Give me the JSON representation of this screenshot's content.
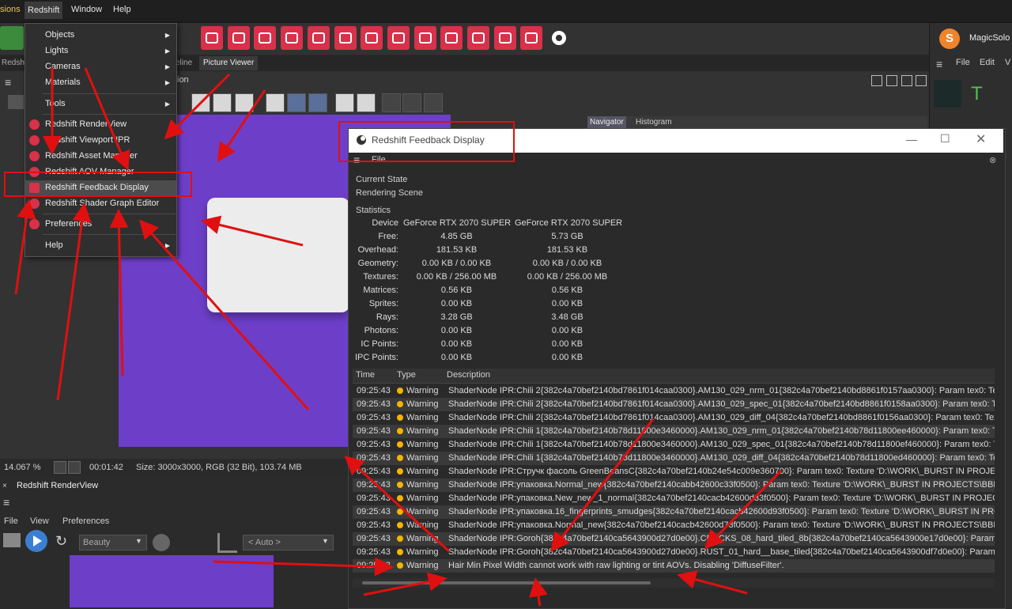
{
  "menubar": {
    "extensions": "sions",
    "redshift": "Redshift",
    "window": "Window",
    "help": "Help"
  },
  "menu": {
    "objects": "Objects",
    "lights": "Lights",
    "cameras": "Cameras",
    "materials": "Materials",
    "tools": "Tools",
    "renderview": "Redshift RenderView",
    "viewport_ipr": "Redshift Viewport IPR",
    "asset_manager": "Redshift Asset Manager",
    "aov_manager": "Redshift AOV Manager",
    "feedback_display": "Redshift Feedback Display",
    "shader_graph": "Redshift Shader Graph Editor",
    "preferences": "Preferences",
    "help": "Help"
  },
  "tabs": {
    "left": "Redsh",
    "timeline": "eline",
    "picture_viewer": "Picture Viewer"
  },
  "viewer": {
    "menu_partial": "ion",
    "navigator_tab": "Navigator",
    "histogram_tab": "Histogram"
  },
  "right_panel": {
    "app_name": "MagicSolo",
    "file": "File",
    "edit": "Edit",
    "v": "V"
  },
  "status": {
    "zoom": "14.067 %",
    "time": "00:01:42",
    "size": "Size: 3000x3000, RGB (32 Bit), 103.74 MB"
  },
  "renderview": {
    "title": "Redshift RenderView",
    "file": "File",
    "view": "View",
    "preferences": "Preferences",
    "aov": "Beauty",
    "auto": "< Auto >"
  },
  "feedback": {
    "title": "Redshift Feedback Display",
    "file_menu": "File",
    "current_state_label": "Current State",
    "current_state_value": "Rendering Scene",
    "statistics_label": "Statistics",
    "stats": [
      {
        "label": "Device",
        "a": "GeForce RTX 2070 SUPER",
        "b": "GeForce RTX 2070 SUPER"
      },
      {
        "label": "Free:",
        "a": "4.85 GB",
        "b": "5.73 GB"
      },
      {
        "label": "Overhead:",
        "a": "181.53 KB",
        "b": "181.53 KB"
      },
      {
        "label": "Geometry:",
        "a": "0.00 KB / 0.00 KB",
        "b": "0.00 KB / 0.00 KB"
      },
      {
        "label": "Textures:",
        "a": "0.00 KB / 256.00 MB",
        "b": "0.00 KB / 256.00 MB"
      },
      {
        "label": "Matrices:",
        "a": "0.56 KB",
        "b": "0.56 KB"
      },
      {
        "label": "Sprites:",
        "a": "0.00 KB",
        "b": "0.00 KB"
      },
      {
        "label": "Rays:",
        "a": "3.28 GB",
        "b": "3.48 GB"
      },
      {
        "label": "Photons:",
        "a": "0.00 KB",
        "b": "0.00 KB"
      },
      {
        "label": "IC Points:",
        "a": "0.00 KB",
        "b": "0.00 KB"
      },
      {
        "label": "IPC Points:",
        "a": "0.00 KB",
        "b": "0.00 KB"
      }
    ],
    "log_headers": {
      "time": "Time",
      "type": "Type",
      "description": "Description"
    },
    "log": [
      {
        "time": "09:25:43",
        "type": "Warning",
        "desc": "ShaderNode IPR:Chili 2{382c4a70bef2140bd7861f014caa0300}.AM130_029_nrm_01{382c4a70bef2140bd8861f0157aa0300}: Param tex0: Te"
      },
      {
        "time": "09:25:43",
        "type": "Warning",
        "desc": "ShaderNode IPR:Chili 2{382c4a70bef2140bd7861f014caa0300}.AM130_029_spec_01{382c4a70bef2140bd8861f0158aa0300}: Param tex0: Te"
      },
      {
        "time": "09:25:43",
        "type": "Warning",
        "desc": "ShaderNode IPR:Chili 2{382c4a70bef2140bd7861f014caa0300}.AM130_029_diff_04{382c4a70bef2140bd8861f0156aa0300}: Param tex0: Tex"
      },
      {
        "time": "09:25:43",
        "type": "Warning",
        "desc": "ShaderNode IPR:Chili 1{382c4a70bef2140b78d11800e3460000}.AM130_029_nrm_01{382c4a70bef2140b78d11800ee460000}: Param tex0: Te"
      },
      {
        "time": "09:25:43",
        "type": "Warning",
        "desc": "ShaderNode IPR:Chili 1{382c4a70bef2140b78d11800e3460000}.AM130_029_spec_01{382c4a70bef2140b78d11800ef460000}: Param tex0: T"
      },
      {
        "time": "09:25:43",
        "type": "Warning",
        "desc": "ShaderNode IPR:Chili 1{382c4a70bef2140b78d11800e3460000}.AM130_029_diff_04{382c4a70bef2140b78d11800ed460000}: Param tex0: Te"
      },
      {
        "time": "09:25:43",
        "type": "Warning",
        "desc": "ShaderNode IPR:Стручк фасоль GreenBeansC{382c4a70bef2140b24e54c009e360700}: Param tex0: Texture 'D:\\WORK\\_BURST IN PROJEC"
      },
      {
        "time": "09:25:43",
        "type": "Warning",
        "desc": "ShaderNode IPR:упаковка.Normal_new{382c4a70bef2140cabb42600c33f0500}: Param tex0: Texture 'D:\\WORK\\_BURST IN PROJECTS\\BBD"
      },
      {
        "time": "09:25:43",
        "type": "Warning",
        "desc": "ShaderNode IPR:упаковка.New_new_1_normal{382c4a70bef2140cacb42600d33f0500}: Param tex0: Texture 'D:\\WORK\\_BURST IN PROJEC"
      },
      {
        "time": "09:25:43",
        "type": "Warning",
        "desc": "ShaderNode IPR:упаковка.16_fingerprints_smudges{382c4a70bef2140cacb42600d93f0500}: Param tex0: Texture 'D:\\WORK\\_BURST IN PRC"
      },
      {
        "time": "09:25:43",
        "type": "Warning",
        "desc": "ShaderNode IPR:упаковка.Normal_new{382c4a70bef2140cacb42600d73f0500}: Param tex0: Texture 'D:\\WORK\\_BURST IN PROJECTS\\BBD"
      },
      {
        "time": "09:25:43",
        "type": "Warning",
        "desc": "ShaderNode IPR:Goroh{382c4a70bef2140ca5643900d27d0e00}.CRACKS_08_hard_tiled_8b{382c4a70bef2140ca5643900e17d0e00}: Param"
      },
      {
        "time": "09:25:43",
        "type": "Warning",
        "desc": "ShaderNode IPR:Goroh{382c4a70bef2140ca5643900d27d0e00}.RUST_01_hard__base_tiled{382c4a70bef2140ca5643900df7d0e00}: Param"
      },
      {
        "time": "09:25:43",
        "type": "Warning",
        "desc": "Hair Min Pixel Width cannot work with raw lighting or tint AOVs. Disabling 'DiffuseFilter'."
      }
    ]
  },
  "colors": {
    "accent_red": "#d8314a",
    "warning": "#f5b400",
    "annotation": "#e01010",
    "purple": "#6d3fc9"
  }
}
